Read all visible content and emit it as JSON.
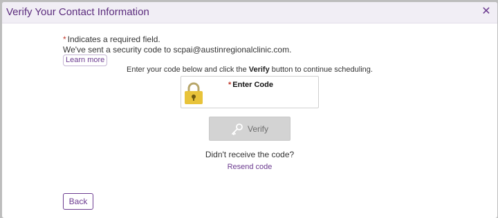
{
  "dialog": {
    "title": "Verify Your Contact Information",
    "close_icon": "close-icon",
    "close_glyph": "✕"
  },
  "notice": {
    "required_marker": "*",
    "required_text": "Indicates a required field.",
    "sent_text": "We've sent a security code to scpai@austinregionalclinic.com.",
    "learn_more_label": "Learn more"
  },
  "instruction": {
    "before": "Enter your code below and click the",
    "emphasis": "Verify",
    "after": "button to continue scheduling."
  },
  "code_field": {
    "required_marker": "*",
    "label": "Enter Code",
    "value": "",
    "icon": "lock-icon"
  },
  "verify_button": {
    "label": "Verify",
    "icon": "key-icon"
  },
  "resend": {
    "question": "Didn't receive the code?",
    "link_label": "Resend code"
  },
  "back_button": {
    "label": "Back"
  },
  "colors": {
    "brand_purple": "#6b3a8f",
    "title_purple": "#5b2c7d",
    "header_bg": "#f1eef5",
    "required_red": "#c0392b",
    "lock_gold": "#e8c33a",
    "disabled_button": "#d3d3d3"
  }
}
